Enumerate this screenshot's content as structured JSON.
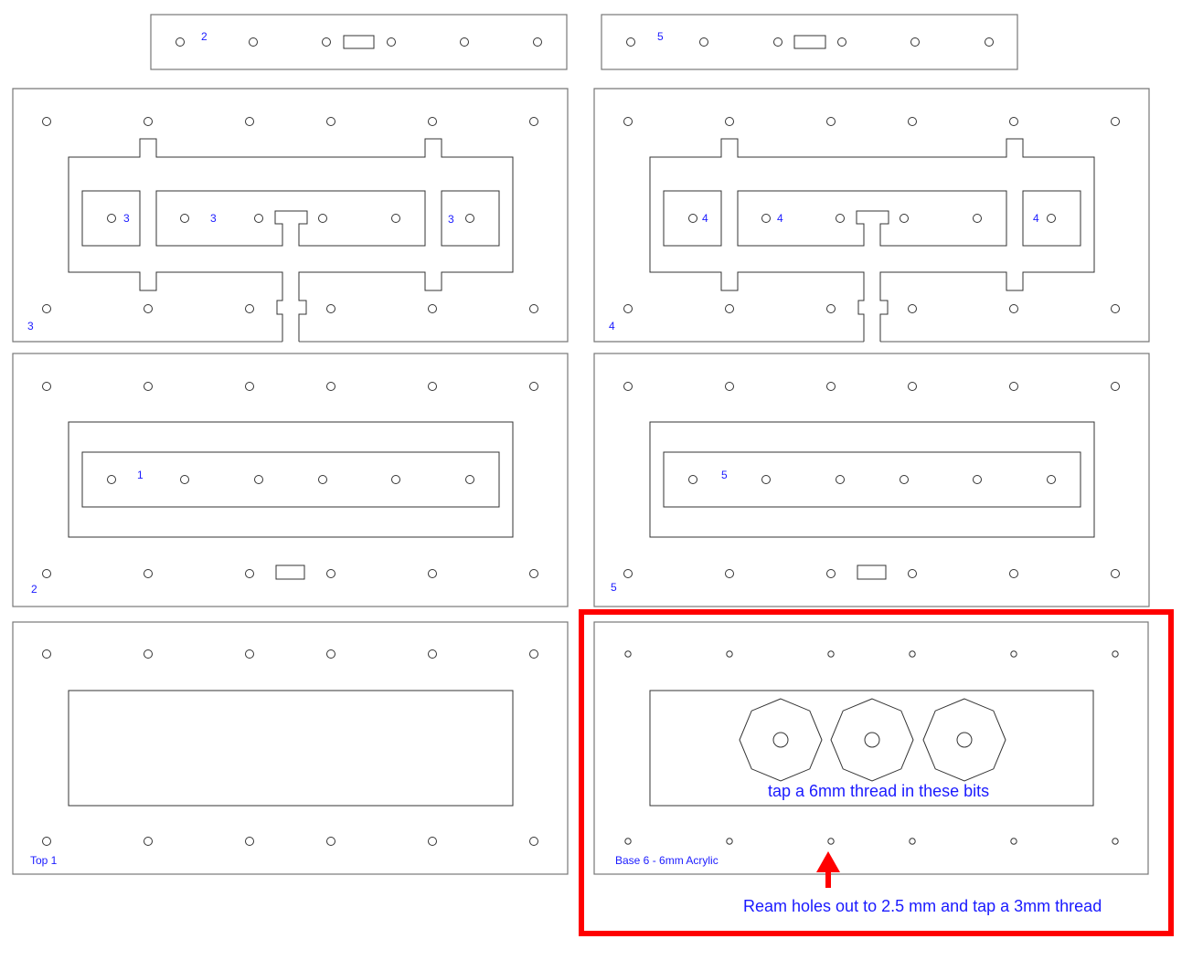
{
  "colors": {
    "annotation": "#1a1aff",
    "highlight": "#ff0000",
    "line": "#333333"
  },
  "labels": {
    "strip_left": "2",
    "strip_right": "5",
    "panel3_a": "3",
    "panel3_b": "3",
    "panel3_c": "3",
    "panel3_corner": "3",
    "panel4_a": "4",
    "panel4_b": "4",
    "panel4_c": "4",
    "panel4_corner": "4",
    "panel2_inner": "1",
    "panel2_corner": "2",
    "panel5_inner": "5",
    "panel5_corner": "5",
    "top1": "Top 1",
    "base6": "Base 6 - 6mm Acrylic"
  },
  "annotations": {
    "tap6": "tap a 6mm thread in these bits",
    "ream": "Ream holes out to 2.5 mm and tap a 3mm thread"
  }
}
